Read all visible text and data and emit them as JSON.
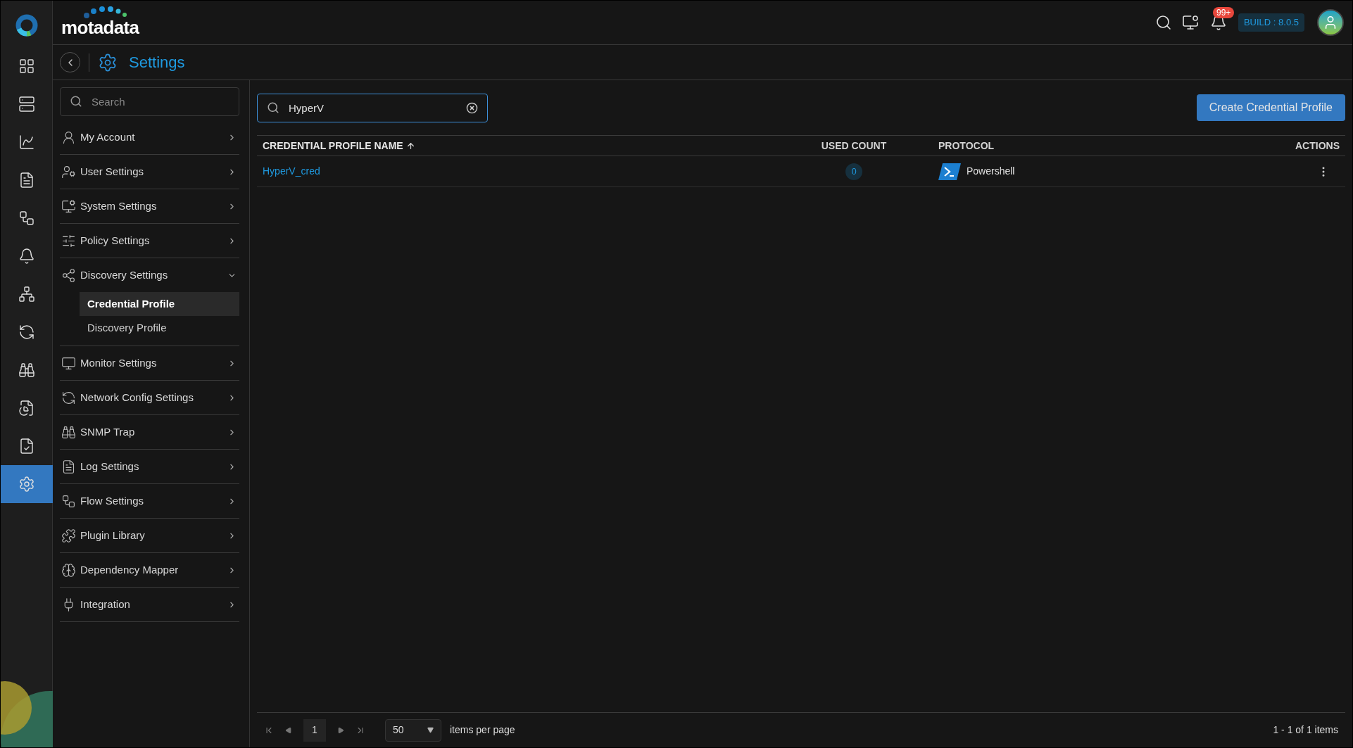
{
  "topbar": {
    "logo": "motadata",
    "notification_badge": "99+",
    "build": "BUILD : 8.0.5"
  },
  "rail": [
    {
      "selected": false
    },
    {
      "selected": false
    },
    {
      "selected": false
    },
    {
      "selected": false
    },
    {
      "selected": false
    },
    {
      "selected": false
    },
    {
      "selected": false
    },
    {
      "selected": false
    },
    {
      "selected": false
    },
    {
      "selected": false
    },
    {
      "selected": false
    },
    {
      "selected": true
    }
  ],
  "page_title": "Settings",
  "sidebar": {
    "search": {
      "placeholder": "Search"
    },
    "items": [
      {
        "label": "My Account",
        "expanded": false
      },
      {
        "label": "User Settings",
        "expanded": false
      },
      {
        "label": "System Settings",
        "expanded": false
      },
      {
        "label": "Policy Settings",
        "expanded": false
      },
      {
        "label": "Discovery Settings",
        "expanded": true,
        "children": [
          {
            "label": "Credential Profile",
            "selected": true
          },
          {
            "label": "Discovery Profile",
            "selected": false
          }
        ]
      },
      {
        "label": "Monitor Settings",
        "expanded": false
      },
      {
        "label": "Network Config Settings",
        "expanded": false
      },
      {
        "label": "SNMP Trap",
        "expanded": false
      },
      {
        "label": "Log Settings",
        "expanded": false
      },
      {
        "label": "Flow Settings",
        "expanded": false
      },
      {
        "label": "Plugin Library",
        "expanded": false
      },
      {
        "label": "Dependency Mapper",
        "expanded": false
      },
      {
        "label": "Integration",
        "expanded": false
      }
    ]
  },
  "search": {
    "value": "HyperV"
  },
  "create_button": "Create Credential Profile",
  "table": {
    "columns": [
      {
        "label": "CREDENTIAL PROFILE NAME",
        "sorted": true
      },
      {
        "label": "USED COUNT",
        "sorted": false
      },
      {
        "label": "PROTOCOL",
        "sorted": false
      },
      {
        "label": "ACTIONS",
        "sorted": false
      }
    ],
    "rows": [
      {
        "name": "HyperV_cred",
        "used_count": "0",
        "protocol": "Powershell"
      }
    ]
  },
  "pagination": {
    "page": "1",
    "per_page": "50",
    "per_page_label": "items per page",
    "summary": "1 - 1 of 1 items"
  }
}
